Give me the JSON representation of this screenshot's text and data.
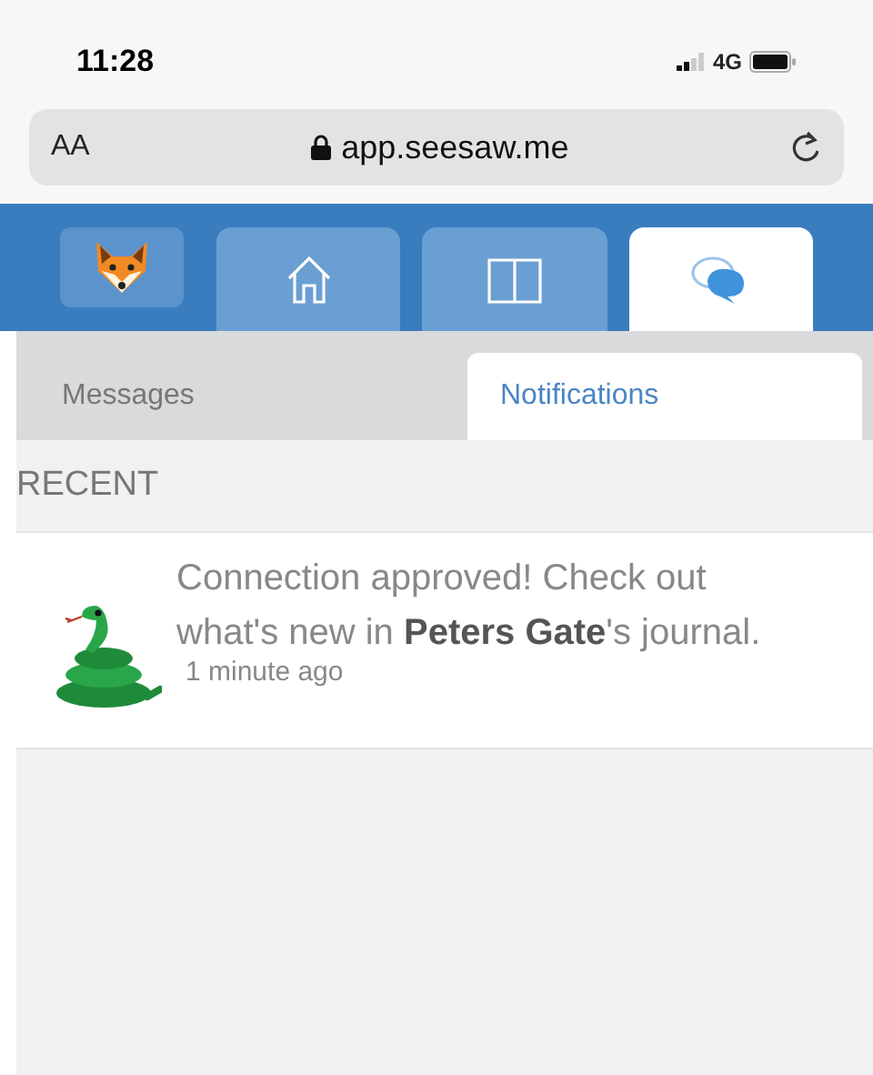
{
  "status_bar": {
    "time": "11:28",
    "network": "4G"
  },
  "address_bar": {
    "text_size": "AA",
    "url": "app.seesaw.me"
  },
  "nav_tabs": [
    {
      "kind": "avatar"
    },
    {
      "kind": "home",
      "selected": false
    },
    {
      "kind": "journal",
      "selected": false
    },
    {
      "kind": "messages",
      "selected": true
    }
  ],
  "sub_tabs": [
    {
      "label": "Messages",
      "selected": false
    },
    {
      "label": "Notifications",
      "selected": true
    }
  ],
  "section_title": "RECENT",
  "notifications": [
    {
      "text": "Connection approved! Check out what's new in **Peters Gate**'s journal.",
      "time": "1 minute ago"
    }
  ]
}
